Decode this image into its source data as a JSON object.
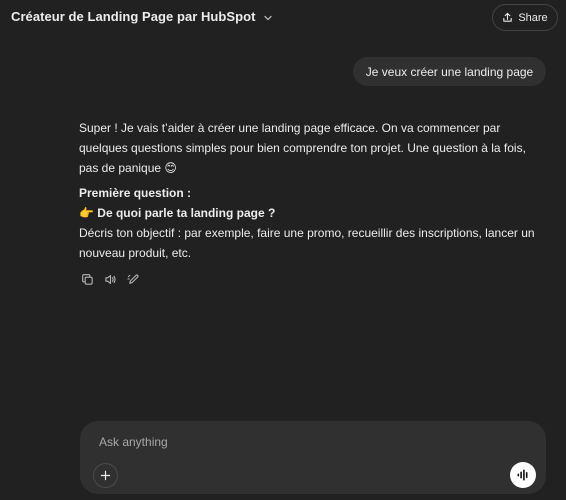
{
  "header": {
    "title": "Créateur de Landing Page par HubSpot",
    "share_label": "Share"
  },
  "conversation": {
    "user_message": "Je veux créer une landing page",
    "assistant": {
      "intro": "Super ! Je vais t’aider à créer une landing page efficace. On va commencer par quelques questions simples pour bien comprendre ton projet. Une question à la fois, pas de panique 😊",
      "first_question_heading": "Première question :",
      "question": "👉 De quoi parle ta landing page ?",
      "description": "Décris ton objectif : par exemple, faire une promo, recueillir des inscriptions, lancer un nouveau produit, etc."
    },
    "actions": [
      "copy-icon",
      "read-aloud-icon",
      "edit-icon"
    ]
  },
  "composer": {
    "placeholder": "Ask anything"
  },
  "colors": {
    "background": "#212121",
    "bubble": "#303030",
    "text": "#ececec",
    "placeholder": "#a8a8a8"
  }
}
